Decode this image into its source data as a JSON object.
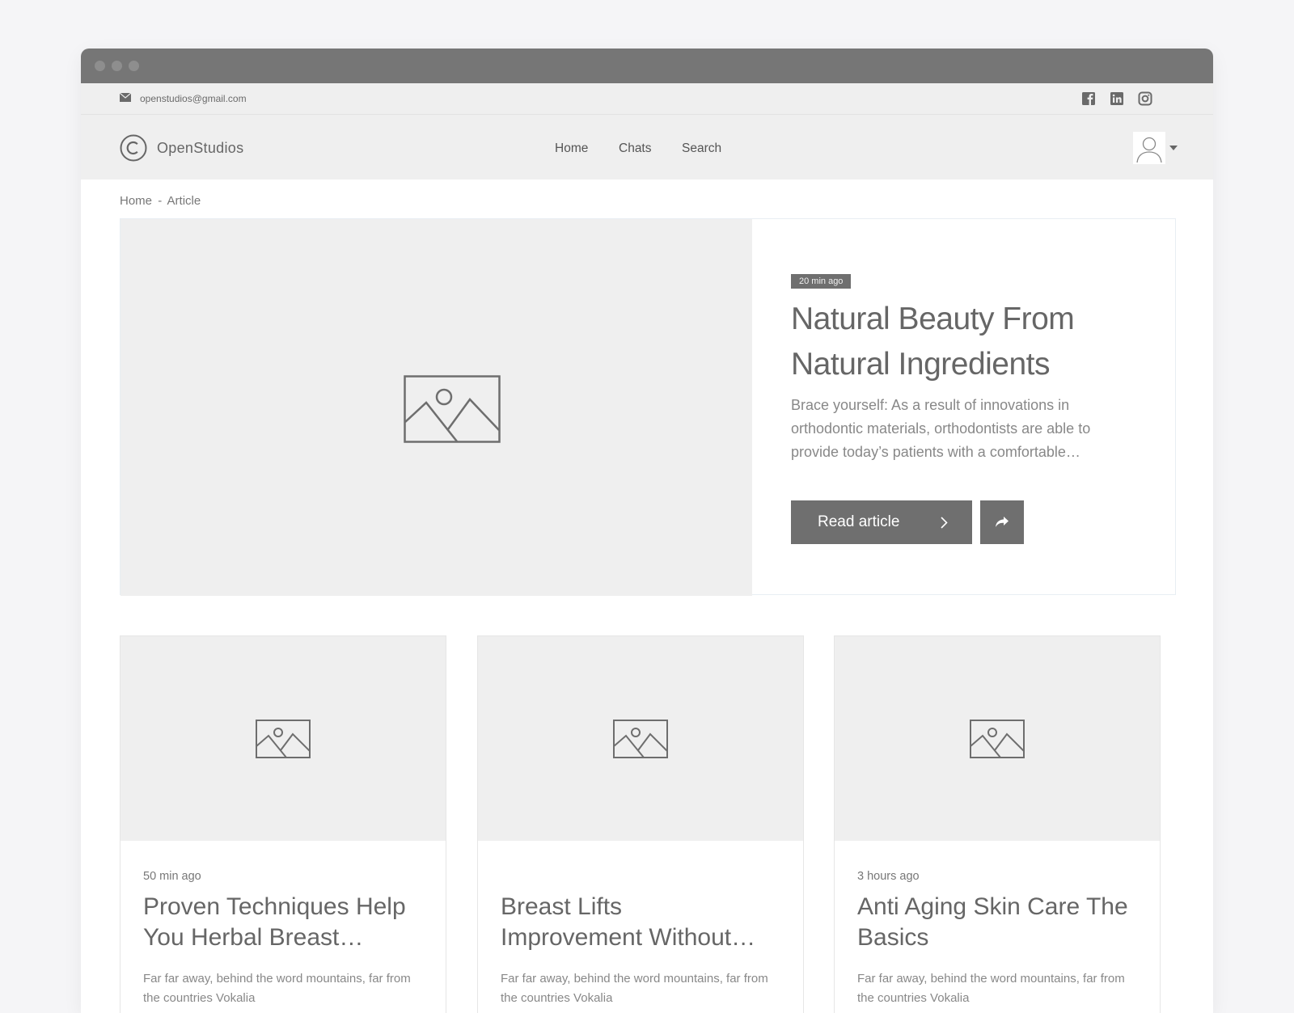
{
  "topbar": {
    "email": "openstudios@gmail.com",
    "social": [
      "facebook-icon",
      "linkedin-icon",
      "instagram-icon"
    ]
  },
  "navbar": {
    "brand": "OpenStudios",
    "items": [
      {
        "label": "Home"
      },
      {
        "label": "Chats"
      },
      {
        "label": "Search"
      }
    ]
  },
  "breadcrumb": {
    "home": "Home",
    "separator": "-",
    "current": "Article"
  },
  "hero": {
    "badge": "20 min ago",
    "title": "Natural Beauty From Natural Ingredients",
    "description": "Brace yourself: As a result of innovations in orthodontic materials, orthodontists are able to provide today’s patients with a comfortable…",
    "read_label": "Read article"
  },
  "cards": [
    {
      "time": "50 min ago",
      "title": "Proven Techniques Help\nYou Herbal Breast…",
      "description": "Far far away, behind the word mountains, far from the countries Vokalia"
    },
    {
      "time": "",
      "title": "Breast Lifts\nImprovement Without…",
      "description": "Far far away, behind the word mountains, far from the countries Vokalia"
    },
    {
      "time": "3 hours ago",
      "title": "Anti Aging Skin Care The\nBasics",
      "description": "Far far away, behind the word mountains, far from the countries Vokalia"
    }
  ],
  "colors": {
    "chrome": "#767676",
    "accent": "#6f6f6f",
    "placeholder": "#efefef"
  }
}
